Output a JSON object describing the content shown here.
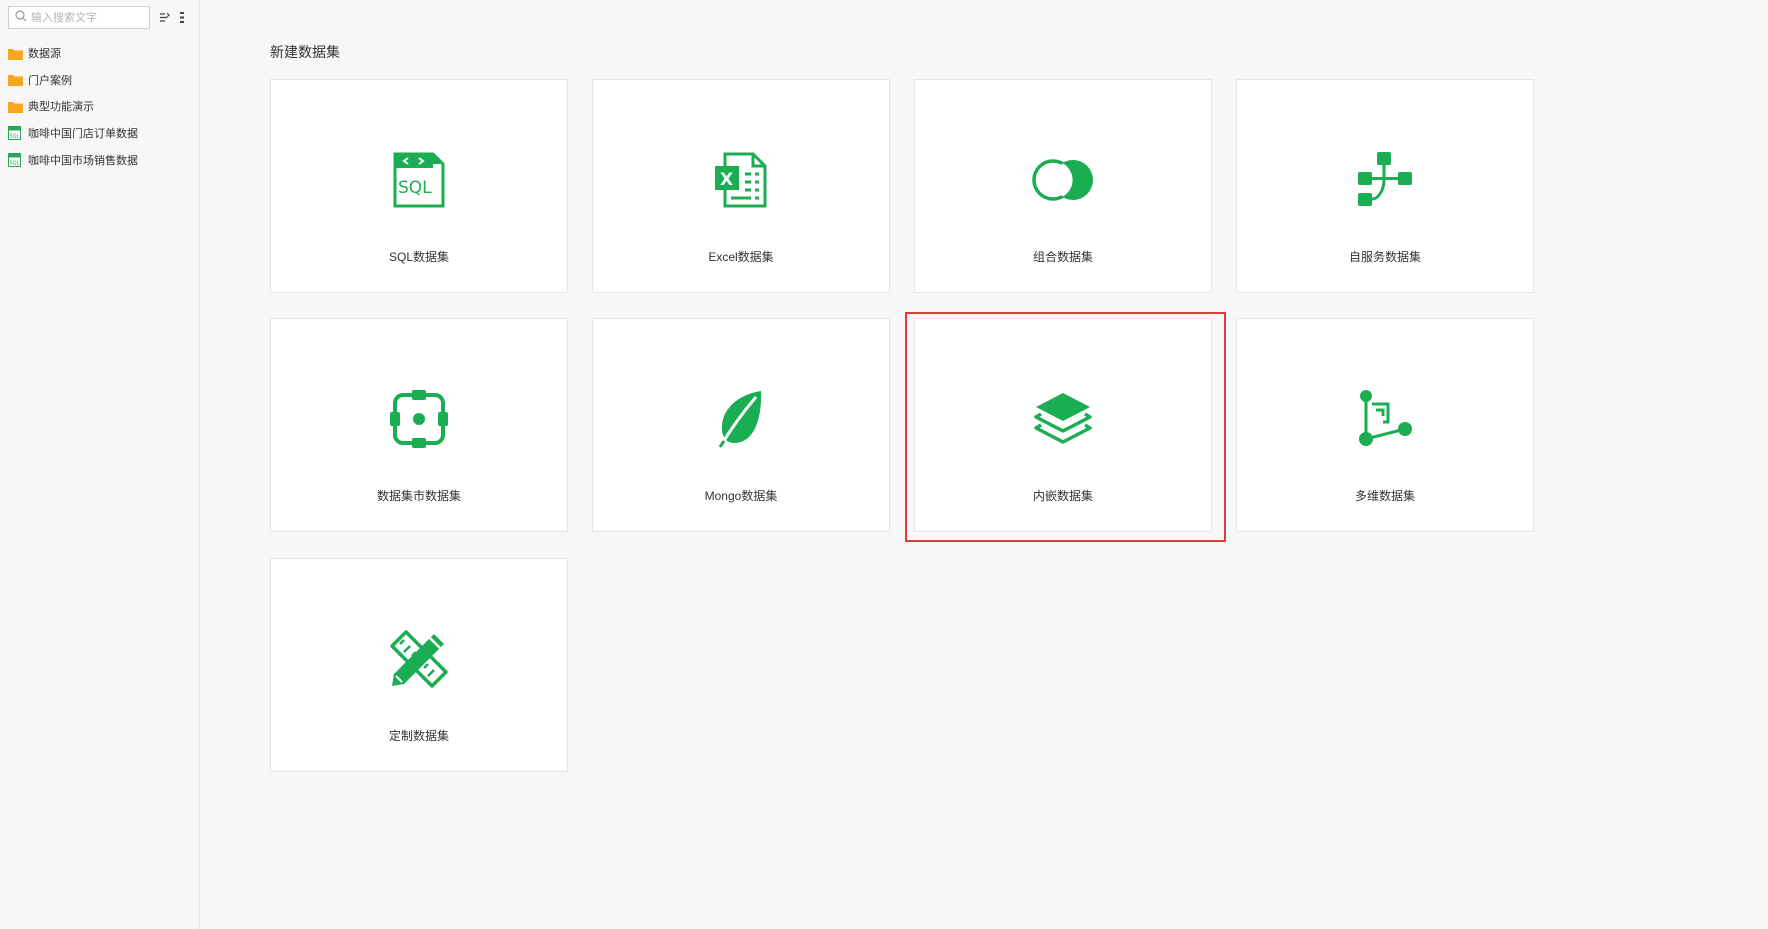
{
  "sidebar": {
    "search_placeholder": "输入搜索文字",
    "tools": [
      "tree-collapse-icon",
      "more-vertical-icon"
    ],
    "items": [
      {
        "label": "数据源",
        "icon": "folder-icon",
        "color": "#f5a623"
      },
      {
        "label": "门户案例",
        "icon": "folder-icon",
        "color": "#f5a623"
      },
      {
        "label": "典型功能演示",
        "icon": "folder-icon",
        "color": "#f5a623"
      },
      {
        "label": "咖啡中国门店订单数据",
        "icon": "sql-dataset-icon",
        "color": "#2aa55a"
      },
      {
        "label": "咖啡中国市场销售数据",
        "icon": "sql-dataset-icon",
        "color": "#2aa55a"
      }
    ]
  },
  "main": {
    "title": "新建数据集",
    "accent_color": "#1aad52",
    "highlight_color": "#e53935",
    "cards": [
      {
        "label": "SQL数据集",
        "icon": "sql-icon"
      },
      {
        "label": "Excel数据集",
        "icon": "excel-icon"
      },
      {
        "label": "组合数据集",
        "icon": "combine-icon"
      },
      {
        "label": "自服务数据集",
        "icon": "self-service-icon"
      },
      {
        "label": "数据集市数据集",
        "icon": "data-mart-icon"
      },
      {
        "label": "Mongo数据集",
        "icon": "mongo-leaf-icon"
      },
      {
        "label": "内嵌数据集",
        "icon": "layers-icon",
        "highlighted": true
      },
      {
        "label": "多维数据集",
        "icon": "multidimensional-icon"
      },
      {
        "label": "定制数据集",
        "icon": "custom-pencil-ruler-icon"
      }
    ]
  }
}
